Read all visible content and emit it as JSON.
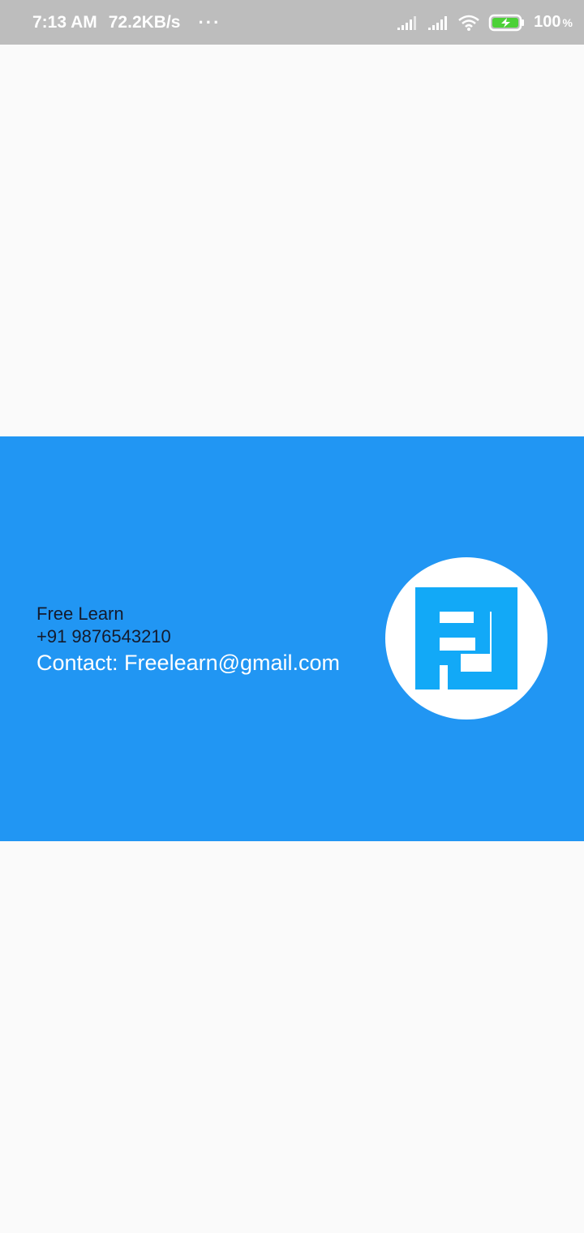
{
  "status_bar": {
    "time": "7:13 AM",
    "speed": "72.2KB/s",
    "more": "···",
    "battery_level": "100",
    "battery_unit": "%"
  },
  "card": {
    "name": "Free Learn",
    "phone": "+91 9876543210",
    "contact": "Contact: Freelearn@gmail.com",
    "logo_icon": "fl-logo-icon",
    "background_color": "#2196f3",
    "logo_color": "#12a9f7"
  }
}
